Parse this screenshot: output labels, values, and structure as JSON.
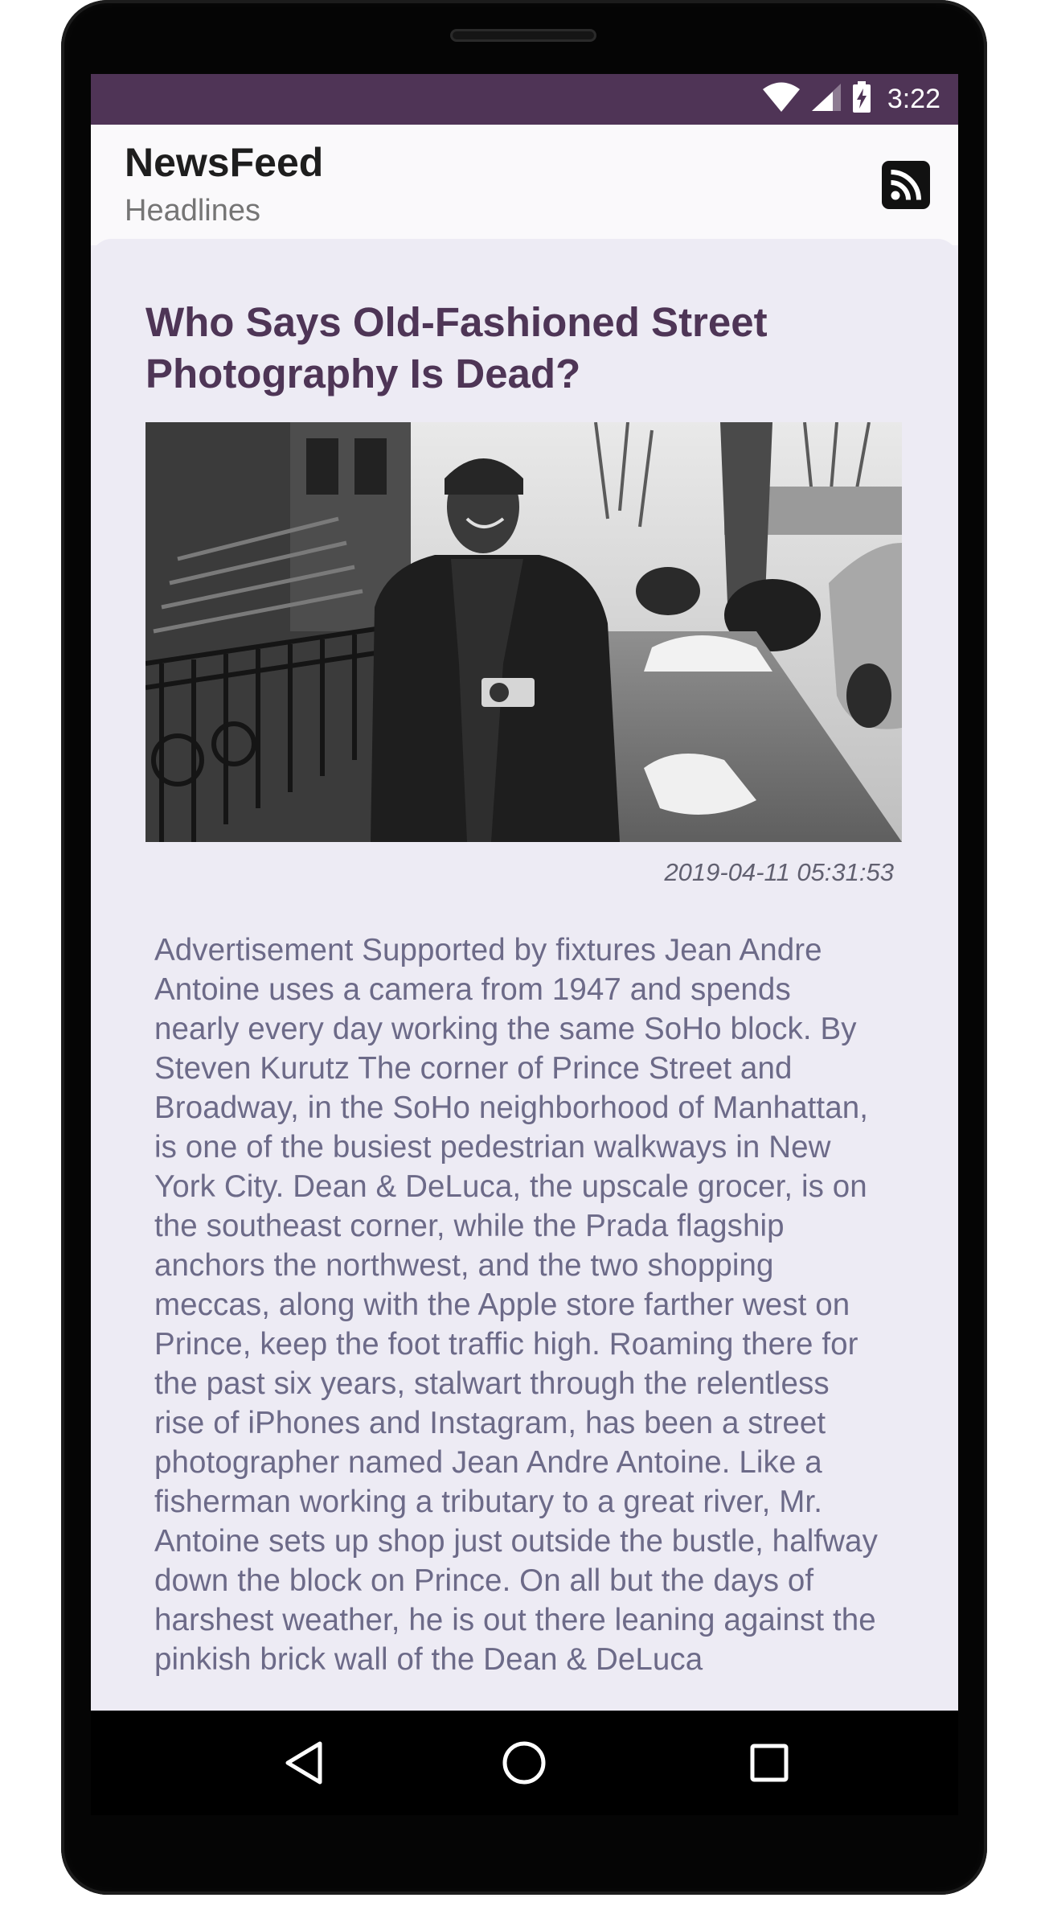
{
  "status_bar": {
    "time": "3:22",
    "background_color": "#4f3456",
    "icons": [
      "wifi-icon",
      "cell-signal-icon",
      "battery-charging-icon"
    ]
  },
  "app_bar": {
    "title": "NewsFeed",
    "subtitle": "Headlines",
    "action_icon": "rss-feed-icon"
  },
  "article": {
    "title": "Who Says Old-Fashioned Street Photography Is Dead?",
    "image_description_icon": "article-photo",
    "timestamp": "2019-04-11 05:31:53",
    "body": "Advertisement Supported by fixtures Jean Andre Antoine uses a camera from 1947 and spends nearly every day working the same SoHo block. By Steven Kurutz The corner of Prince Street and Broadway, in the SoHo neighborhood of Manhattan, is one of the busiest pedestrian walkways in New York City. Dean & DeLuca, the upscale grocer, is on the southeast corner, while the Prada flagship anchors the northwest, and the two shopping meccas, along with the Apple store farther west on Prince, keep the foot traffic high. Roaming there for the past six years, stalwart through the relentless rise of iPhones and Instagram, has been a street photographer named Jean Andre Antoine. Like a fisherman working a tributary to a great river, Mr. Antoine sets up shop just outside the bustle, halfway down the block on Prince. On all but the days of harshest weather, he is out there leaning against the pinkish brick wall of the Dean & DeLuca",
    "title_color": "#4e3556",
    "body_color": "#6c6a88"
  },
  "nav_bar": {
    "buttons": [
      "back-icon",
      "home-icon",
      "recents-icon"
    ]
  }
}
